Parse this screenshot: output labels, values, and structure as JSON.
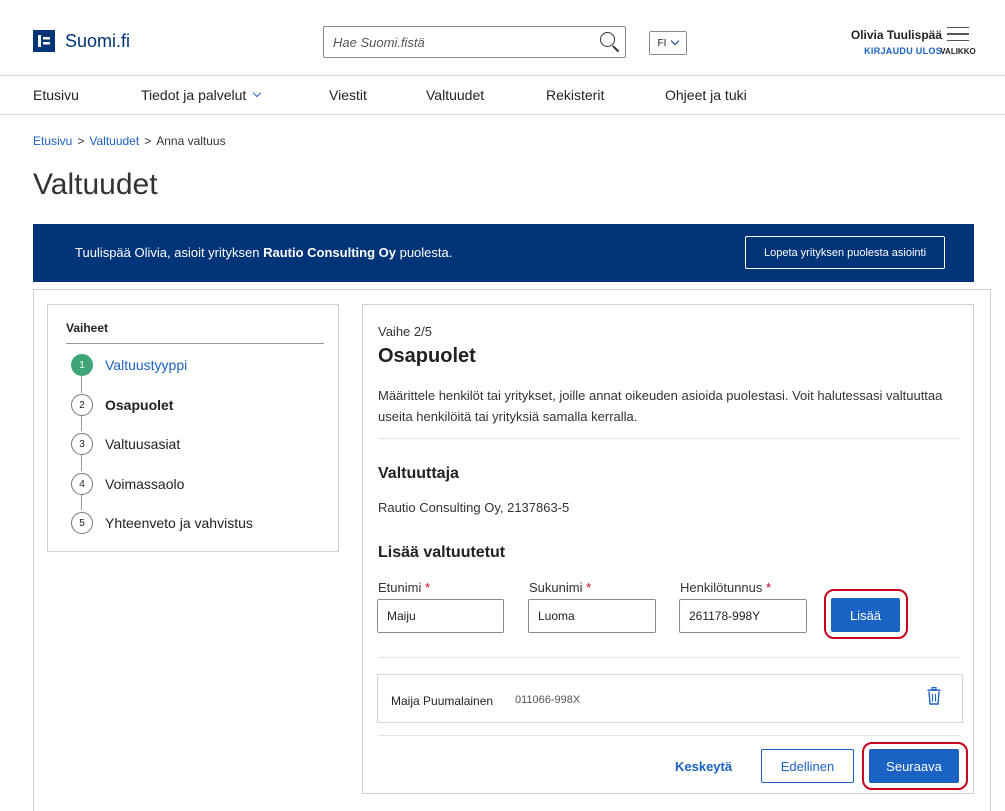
{
  "header": {
    "logo_mark": "F",
    "logo_text": "Suomi.fi",
    "search_placeholder": "Hae Suomi.fistä",
    "lang": "FI",
    "user_name": "Olivia Tuulispää",
    "logout": "KIRJAUDU ULOS",
    "menu_label": "VALIKKO"
  },
  "nav": {
    "items": [
      "Etusivu",
      "Tiedot ja palvelut",
      "Viestit",
      "Valtuudet",
      "Rekisterit",
      "Ohjeet ja tuki"
    ]
  },
  "breadcrumb": {
    "items": [
      "Etusivu",
      "Valtuudet",
      "Anna valtuus"
    ],
    "separator": ">"
  },
  "page_title": "Valtuudet",
  "banner": {
    "prefix": "Tuulispää Olivia, asioit yrityksen ",
    "company": "Rautio Consulting Oy",
    "suffix": " puolesta.",
    "button": "Lopeta yrityksen puolesta asiointi"
  },
  "steps": {
    "title": "Vaiheet",
    "items": [
      {
        "num": "1",
        "label": "Valtuustyyppi"
      },
      {
        "num": "2",
        "label": "Osapuolet"
      },
      {
        "num": "3",
        "label": "Valtuusasiat"
      },
      {
        "num": "4",
        "label": "Voimassaolo"
      },
      {
        "num": "5",
        "label": "Yhteenveto ja vahvistus"
      }
    ]
  },
  "main": {
    "phase": "Vaihe 2/5",
    "title": "Osapuolet",
    "intro": "Määrittele henkilöt tai yritykset, joille annat oikeuden asioida puolestasi. Voit halutessasi valtuuttaa useita henkilöitä tai yrityksiä samalla kerralla.",
    "grantor_heading": "Valtuuttaja",
    "grantor_value": "Rautio Consulting Oy, 2137863-5",
    "add_heading": "Lisää valtuutetut",
    "fields": {
      "first_name_label": "Etunimi",
      "first_name_value": "Maiju",
      "last_name_label": "Sukunimi",
      "last_name_value": "Luoma",
      "ssn_label": "Henkilötunnus",
      "ssn_value": "261178-998Y",
      "required_mark": "*"
    },
    "add_button": "Lisää",
    "entries": [
      {
        "name": "Maija Puumalainen",
        "id": "011066-998X"
      }
    ],
    "actions": {
      "cancel": "Keskeytä",
      "previous": "Edellinen",
      "next": "Seuraava"
    }
  },
  "colors": {
    "brand": "#003479",
    "link": "#1a62c4",
    "step_done": "#3fa576",
    "highlight": "#c8001e",
    "required": "#c40020"
  }
}
